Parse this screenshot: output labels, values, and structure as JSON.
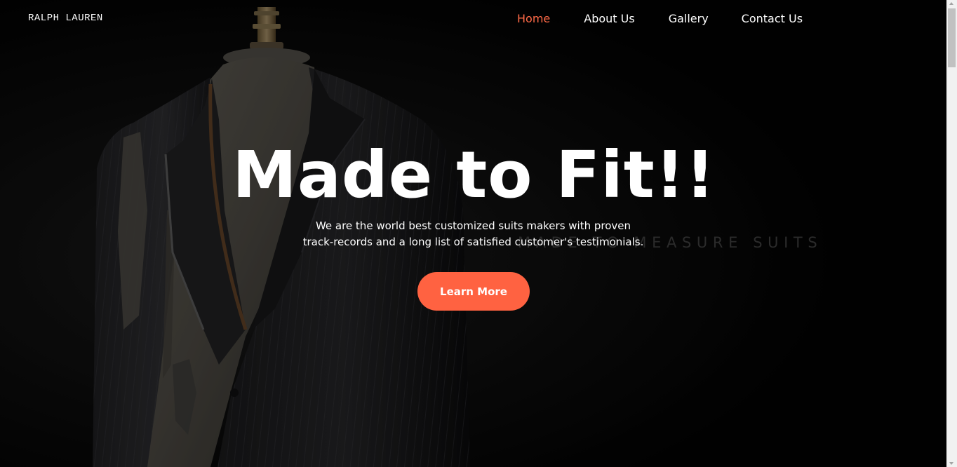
{
  "header": {
    "logo_text": "RALPH LAUREN"
  },
  "nav": {
    "items": [
      {
        "label": "Home",
        "active": true
      },
      {
        "label": "About Us",
        "active": false
      },
      {
        "label": "Gallery",
        "active": false
      },
      {
        "label": "Contact Us",
        "active": false
      }
    ]
  },
  "hero": {
    "title": "Made to Fit!!",
    "subtitle_line1": "We are the world best customized suits makers with proven",
    "subtitle_line2": "track-records and a long list of satisfied customer's testimonials.",
    "cta_label": "Learn More",
    "background_watermark": "MADE TO MEASURE SUITS"
  },
  "colors": {
    "accent": "#ff6241",
    "nav_active": "#ff6a47",
    "background": "#020202",
    "text": "#ffffff"
  },
  "icons": {
    "scroll_up": "scroll-up-arrow-icon",
    "scroll_down": "scroll-down-arrow-icon"
  }
}
